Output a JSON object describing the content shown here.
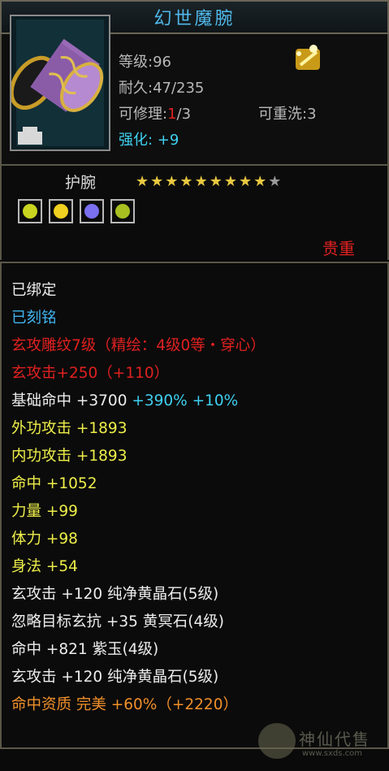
{
  "tooltip": {
    "title": "幻世魔腕",
    "stats": {
      "level": "等级:96",
      "durability": "耐久:47/235",
      "repair_label": "可修理:",
      "repair_current": "1",
      "repair_total": "/3",
      "rewash": "可重洗:3",
      "enhance": "强化: +9"
    },
    "slot": "护腕",
    "stars": {
      "filled": 9,
      "total": 10
    },
    "gem_slots": [
      {
        "name": "gem-green",
        "color": "#c8d420"
      },
      {
        "name": "gem-yellow",
        "color": "#f0d020"
      },
      {
        "name": "gem-purple",
        "color": "#7a70f0"
      },
      {
        "name": "gem-green",
        "color": "#a8c020"
      }
    ],
    "rarity": "贵重",
    "lines": [
      {
        "parts": [
          {
            "t": "已绑定",
            "c": "w"
          }
        ]
      },
      {
        "parts": [
          {
            "t": "已刻铭",
            "c": "b"
          }
        ]
      },
      {
        "parts": [
          {
            "t": "玄攻雕纹7级（精绘：4级0等・穿心）",
            "c": "r"
          }
        ]
      },
      {
        "parts": [
          {
            "t": "玄攻击+250（+110）",
            "c": "r"
          }
        ]
      },
      {
        "parts": [
          {
            "t": "基础命中 +3700 ",
            "c": "w"
          },
          {
            "t": "+390% +10%",
            "c": "c"
          }
        ]
      },
      {
        "parts": [
          {
            "t": "外功攻击 +1893",
            "c": "y"
          }
        ]
      },
      {
        "parts": [
          {
            "t": "内功攻击 +1893",
            "c": "y"
          }
        ]
      },
      {
        "parts": [
          {
            "t": "命中 +1052",
            "c": "y"
          }
        ]
      },
      {
        "parts": [
          {
            "t": "力量 +99",
            "c": "y"
          }
        ]
      },
      {
        "parts": [
          {
            "t": "体力 +98",
            "c": "y"
          }
        ]
      },
      {
        "parts": [
          {
            "t": "身法 +54",
            "c": "y"
          }
        ]
      },
      {
        "parts": [
          {
            "t": "玄攻击 +120 纯净黄晶石(5级)",
            "c": "w"
          }
        ]
      },
      {
        "parts": [
          {
            "t": "忽略目标玄抗 +35 黄冥石(4级)",
            "c": "w"
          }
        ]
      },
      {
        "parts": [
          {
            "t": "命中 +821 紫玉(4级)",
            "c": "w"
          }
        ]
      },
      {
        "parts": [
          {
            "t": "玄攻击 +120 纯净黄晶石(5级)",
            "c": "w"
          }
        ]
      },
      {
        "parts": [
          {
            "t": "命中资质  完美 +60%（+2220）",
            "c": "o"
          }
        ]
      }
    ]
  },
  "watermark": {
    "text": "神仙代售",
    "url": "www.sxds.com"
  },
  "colors": {
    "title": "#4fb8ea",
    "star_filled": "#e8c840",
    "star_empty": "#9a9a9a"
  }
}
